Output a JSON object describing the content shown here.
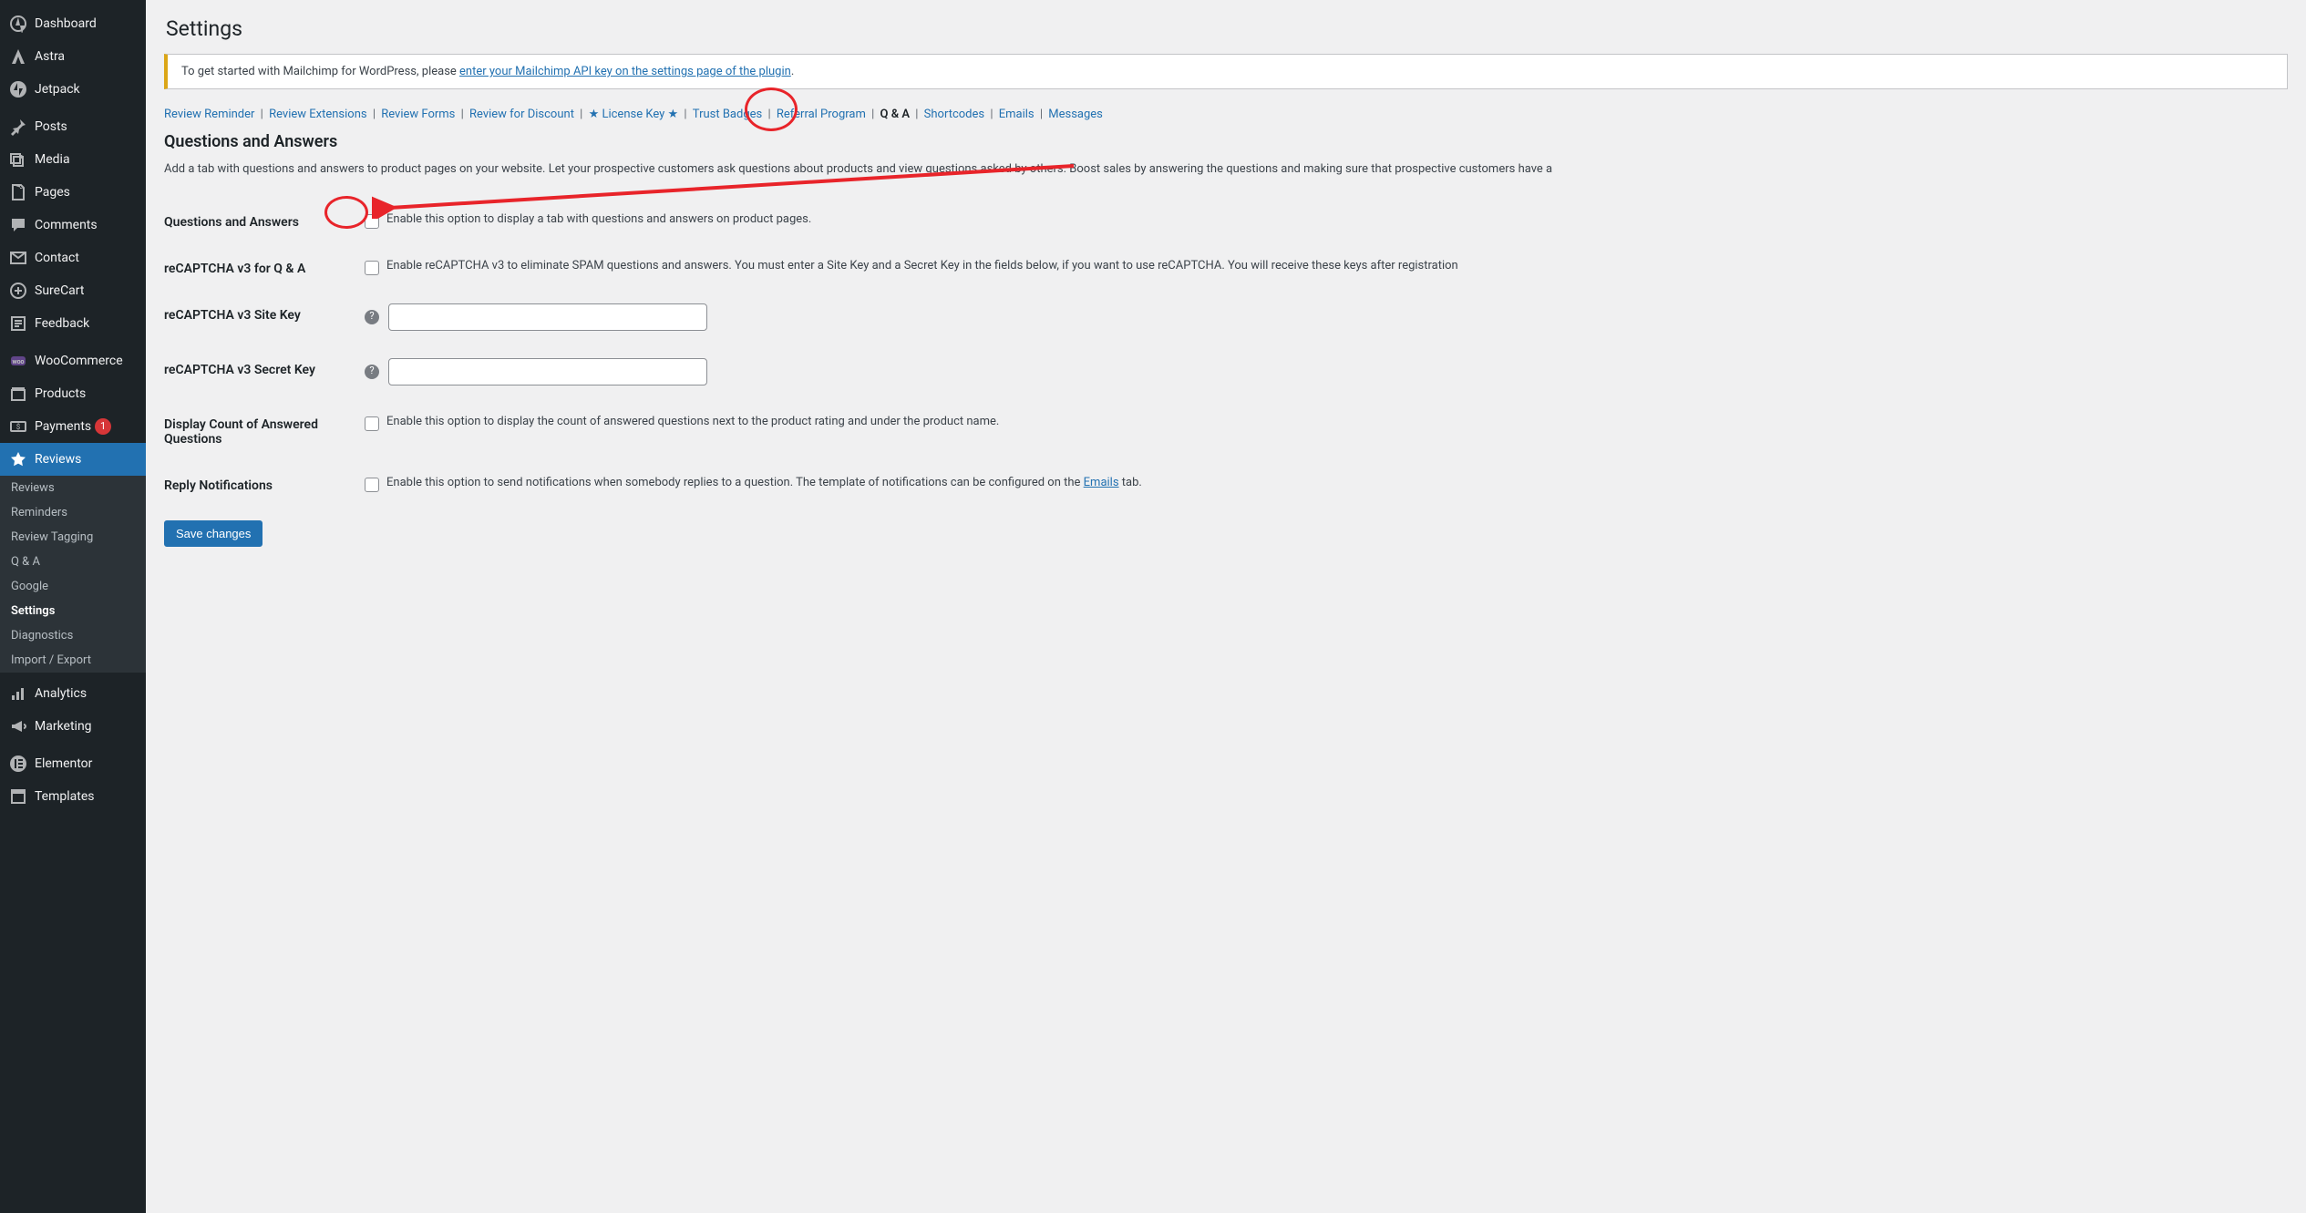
{
  "sidebar": {
    "items": [
      {
        "label": "Dashboard",
        "icon": "dash"
      },
      {
        "label": "Astra",
        "icon": "astra"
      },
      {
        "label": "Jetpack",
        "icon": "jetpack"
      },
      {
        "label": "Posts",
        "icon": "pin"
      },
      {
        "label": "Media",
        "icon": "media"
      },
      {
        "label": "Pages",
        "icon": "pages"
      },
      {
        "label": "Comments",
        "icon": "comment"
      },
      {
        "label": "Contact",
        "icon": "mail"
      },
      {
        "label": "SureCart",
        "icon": "surecart"
      },
      {
        "label": "Feedback",
        "icon": "feedback"
      },
      {
        "label": "WooCommerce",
        "icon": "woo"
      },
      {
        "label": "Products",
        "icon": "products"
      },
      {
        "label": "Payments",
        "icon": "payments",
        "badge": "1"
      },
      {
        "label": "Reviews",
        "icon": "star",
        "current": true
      },
      {
        "label": "Analytics",
        "icon": "analytics"
      },
      {
        "label": "Marketing",
        "icon": "marketing"
      },
      {
        "label": "Elementor",
        "icon": "elementor"
      },
      {
        "label": "Templates",
        "icon": "templates"
      }
    ],
    "submenu": [
      {
        "label": "Reviews"
      },
      {
        "label": "Reminders"
      },
      {
        "label": "Review Tagging"
      },
      {
        "label": "Q & A"
      },
      {
        "label": "Google"
      },
      {
        "label": "Settings",
        "current": true
      },
      {
        "label": "Diagnostics"
      },
      {
        "label": "Import / Export"
      }
    ]
  },
  "page": {
    "title": "Settings",
    "notice_prefix": "To get started with Mailchimp for WordPress, please ",
    "notice_link": "enter your Mailchimp API key on the settings page of the plugin",
    "notice_suffix": "."
  },
  "tabs": [
    "Review Reminder",
    "Review Extensions",
    "Review Forms",
    "Review for Discount",
    "★ License Key ★",
    "Trust Badges",
    "Referral Program",
    "Q & A",
    "Shortcodes",
    "Emails",
    "Messages"
  ],
  "section": {
    "title": "Questions and Answers",
    "desc": "Add a tab with questions and answers to product pages on your website. Let your prospective customers ask questions about products and view questions asked by others. Boost sales by answering the questions and making sure that prospective customers have a"
  },
  "form": {
    "qa_label": "Questions and Answers",
    "qa_desc": "Enable this option to display a tab with questions and answers on product pages.",
    "recaptcha_enable_label": "reCAPTCHA v3 for Q & A",
    "recaptcha_enable_desc": "Enable reCAPTCHA v3 to eliminate SPAM questions and answers. You must enter a Site Key and a Secret Key in the fields below, if you want to use reCAPTCHA. You will receive these keys after registration",
    "site_key_label": "reCAPTCHA v3 Site Key",
    "site_key_value": "",
    "secret_key_label": "reCAPTCHA v3 Secret Key",
    "secret_key_value": "",
    "display_count_label": "Display Count of Answered Questions",
    "display_count_desc": "Enable this option to display the count of answered questions next to the product rating and under the product name.",
    "reply_label": "Reply Notifications",
    "reply_desc_prefix": "Enable this option to send notifications when somebody replies to a question. The template of notifications can be configured on the ",
    "reply_link": "Emails",
    "reply_desc_suffix": " tab.",
    "save_label": "Save changes"
  }
}
